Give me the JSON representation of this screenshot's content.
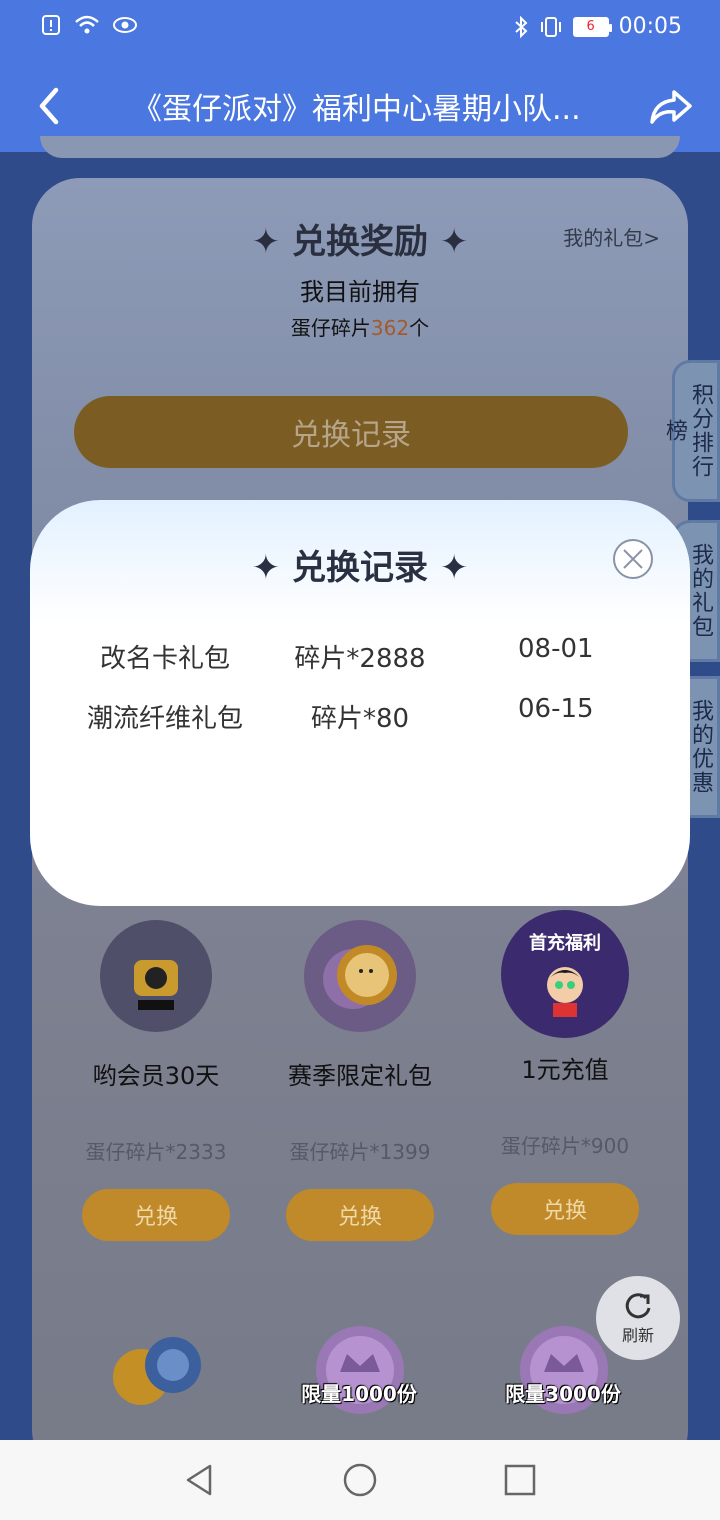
{
  "status_bar": {
    "time": "00:05",
    "battery_level": "6"
  },
  "header": {
    "title": "《蛋仔派对》福利中心暑期小队..."
  },
  "exchange": {
    "section_title": "兑换奖励",
    "my_gifts_link": "我的礼包>",
    "own_label": "我目前拥有",
    "count_prefix": "蛋仔碎片",
    "count_value": "362",
    "count_suffix": "个",
    "record_button": "兑换记录"
  },
  "side_tabs": [
    "积分排行榜",
    "我的礼包",
    "我的优惠券"
  ],
  "items": [
    {
      "name": "哟会员30天",
      "cost": "蛋仔碎片*2333",
      "button": "兑换"
    },
    {
      "name": "赛季限定礼包",
      "cost": "蛋仔碎片*1399",
      "button": "兑换"
    },
    {
      "name": "1元充值",
      "cost": "蛋仔碎片*900",
      "button": "兑换"
    }
  ],
  "avatar_text": {
    "recharge_banner": "首充福利"
  },
  "bottom_items": [
    {
      "label": ""
    },
    {
      "label": "限量1000份"
    },
    {
      "label": "限量3000份"
    }
  ],
  "refresh_label": "刷新",
  "modal": {
    "title": "兑换记录",
    "records": [
      {
        "name": "改名卡礼包",
        "cost": "碎片*2888",
        "date": "08-01"
      },
      {
        "name": "潮流纤维礼包",
        "cost": "碎片*80",
        "date": "06-15"
      }
    ]
  },
  "colors": {
    "header_bg": "#4a77e0",
    "accent_orange": "#e8a02a",
    "modal_bg": "#ffffff"
  }
}
